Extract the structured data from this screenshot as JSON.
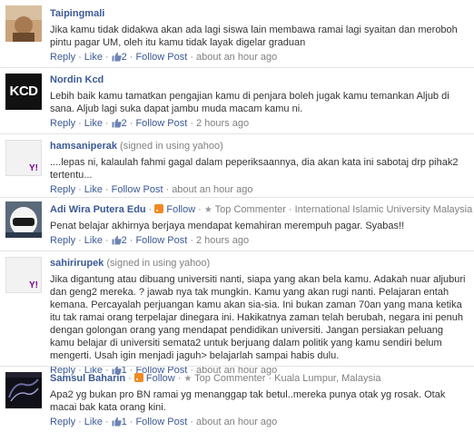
{
  "labels": {
    "reply": "Reply",
    "like": "Like",
    "follow_post": "Follow Post",
    "follow": "Follow",
    "top_commenter": "Top Commenter",
    "dot": "·"
  },
  "comments": [
    {
      "author": "Taipingmali",
      "text": "Jika kamu tidak didakwa akan ada lagi siswa lain membawa ramai lagi syaitan dan meroboh pintu pagar UM, oleh itu kamu tidak layak digelar graduan",
      "likes": "2",
      "time": "about an hour ago"
    },
    {
      "author": "Nordin Kcd",
      "avatar_text": "KCD",
      "text": "Lebih baik kamu tamatkan pengajian kamu di penjara boleh jugak kamu temankan Aljub di sana. Aljub lagi suka dapat jambu muda macam kamu ni.",
      "likes": "2",
      "time": "2 hours ago"
    },
    {
      "author": "hamsaniperak",
      "signed": "(signed in using yahoo)",
      "avatar_text": "Y!",
      "text": "....lepas ni, kalaulah fahmi gagal dalam peperiksaannya, dia akan kata ini sabotaj drp pihak2 tertentu...",
      "time": "about an hour ago"
    },
    {
      "author": "Adi Wira Putera Edu",
      "location": "International Islamic University Malaysia",
      "text": "Penat belajar akhirnya berjaya mendapat kemahiran merempuh pagar. Syabas!!",
      "likes": "2",
      "time": "2 hours ago"
    },
    {
      "author": "sahirirupek",
      "signed": "(signed in using yahoo)",
      "avatar_text": "Y!",
      "text": "Jika digantung atau dibuang universiti nanti, siapa yang akan bela kamu. Adakah nuar aljuburi dan geng2 mereka. ? jawab nya tak mungkin. Kamu yang akan rugi nanti. Pelajaran entah kemana. Percayalah perjuangan kamu akan sia-sia. Ini bukan zaman 70an yang mana ketika itu tak ramai orang terpelajar dinegara ini. Hakikatnya zaman telah berubah, negara ini penuh dengan golongan orang yang mendapat pendidikan universiti. Jangan persiakan peluang kamu belajar di universiti semata2 untuk berjuang dalam politik yang kamu sendiri belum mengerti. Usah igin menjadi jaguh> belajarlah sampai habis dulu.",
      "likes": "1",
      "time": "about an hour ago"
    },
    {
      "author": "Samsul Baharin",
      "location": "Kuala Lumpur, Malaysia",
      "text": "Apa2 yg bukan pro BN ramai yg menanggap tak betul..mereka punya otak yg rosak. Otak macai bak kata orang kini.",
      "likes": "1",
      "time": "about an hour ago"
    }
  ],
  "colors": {
    "link": "#3b5998",
    "meta": "#808080",
    "text": "#333333",
    "separator": "#e3e3e3",
    "yahoo": "#7b0099",
    "rss": "#f08a24"
  }
}
